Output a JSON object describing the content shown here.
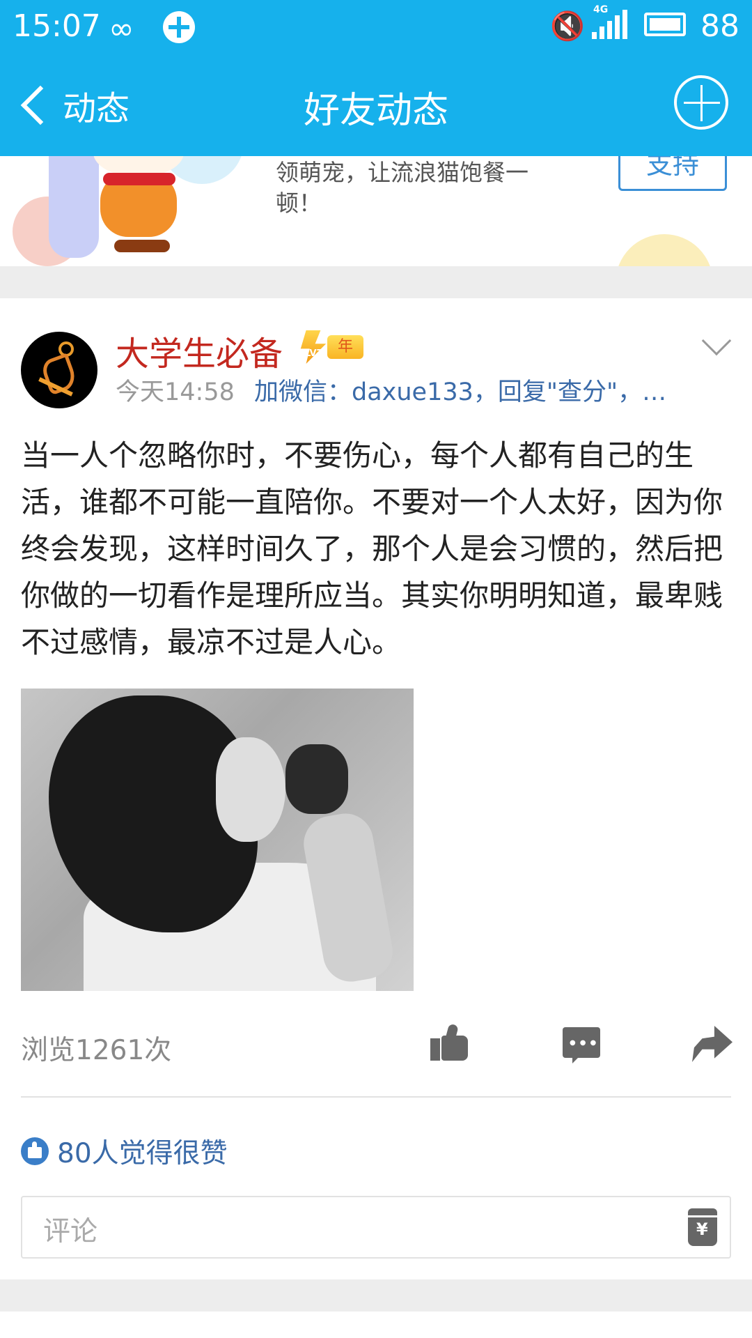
{
  "status_bar": {
    "time": "15:07",
    "network": "4G",
    "battery": "88"
  },
  "header": {
    "back_label": "动态",
    "title": "好友动态"
  },
  "ad": {
    "text": "领萌宠，让流浪猫饱餐一顿！",
    "button_label": "支持"
  },
  "post": {
    "author": "大学生必备",
    "badge_level": "LV7",
    "badge_year": "年",
    "time": "今天14:58",
    "link_text": "加微信：daxue133，回复\"查分\"，…",
    "content": "当一人个忽略你时，不要伤心，每个人都有自己的生活，谁都不可能一直陪你。不要对一个人太好，因为你终会发现，这样时间久了，那个人是会习惯的，然后把你做的一切看作是理所应当。其实你明明知道，最卑贱不过感情，最凉不过是人心。",
    "views": "浏览1261次",
    "likes_text": "80人觉得很赞",
    "comment_placeholder": "评论"
  },
  "colors": {
    "header_bg": "#16b1ec",
    "author": "#c3281f",
    "link": "#3a6aa8"
  }
}
